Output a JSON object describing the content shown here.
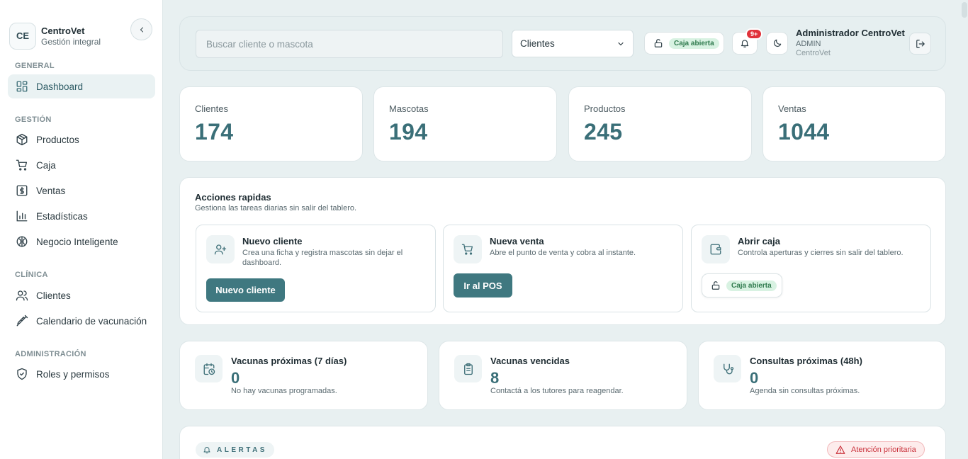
{
  "brand": {
    "initials": "CE",
    "name": "CentroVet",
    "subtitle": "Gestión integral"
  },
  "sidebar": {
    "sections": [
      {
        "label": "GENERAL"
      },
      {
        "label": "GESTIÓN"
      },
      {
        "label": "CLÍNICA"
      },
      {
        "label": "ADMINISTRACIÓN"
      }
    ],
    "items": [
      {
        "label": "Dashboard",
        "icon": "dashboard-icon",
        "active": true
      },
      {
        "label": "Productos",
        "icon": "box-icon"
      },
      {
        "label": "Caja",
        "icon": "cart-icon"
      },
      {
        "label": "Ventas",
        "icon": "dollar-icon"
      },
      {
        "label": "Estadísticas",
        "icon": "bar-chart-icon"
      },
      {
        "label": "Negocio Inteligente",
        "icon": "brain-icon"
      },
      {
        "label": "Clientes",
        "icon": "users-icon"
      },
      {
        "label": "Calendario de vacunación",
        "icon": "syringe-icon"
      },
      {
        "label": "Roles y permisos",
        "icon": "shield-icon"
      }
    ]
  },
  "topbar": {
    "search_placeholder": "Buscar cliente o mascota",
    "search_value": "",
    "select_value": "Clientes",
    "caja_status": "Caja abierta",
    "notifications_count": "9+",
    "user": {
      "name": "Administrador CentroVet",
      "role": "ADMIN",
      "org": "CentroVet"
    }
  },
  "stats": [
    {
      "label": "Clientes",
      "value": "174"
    },
    {
      "label": "Mascotas",
      "value": "194"
    },
    {
      "label": "Productos",
      "value": "245"
    },
    {
      "label": "Ventas",
      "value": "1044"
    }
  ],
  "quick_actions": {
    "title": "Acciones rapidas",
    "subtitle": "Gestiona las tareas diarias sin salir del tablero.",
    "cards": [
      {
        "title": "Nuevo cliente",
        "desc": "Crea una ficha y registra mascotas sin dejar el dashboard.",
        "button": "Nuevo cliente",
        "icon": "user-plus-icon"
      },
      {
        "title": "Nueva venta",
        "desc": "Abre el punto de venta y cobra al instante.",
        "button": "Ir al POS",
        "icon": "cart-icon"
      },
      {
        "title": "Abrir caja",
        "desc": "Controla aperturas y cierres sin salir del tablero.",
        "status": "Caja abierta",
        "icon": "wallet-icon"
      }
    ]
  },
  "info_cards": [
    {
      "title": "Vacunas próximas (7 días)",
      "value": "0",
      "desc": "No hay vacunas programadas.",
      "icon": "calendar-clock-icon"
    },
    {
      "title": "Vacunas vencidas",
      "value": "8",
      "desc": "Contactá a los tutores para reagendar.",
      "icon": "clipboard-icon"
    },
    {
      "title": "Consultas próximas (48h)",
      "value": "0",
      "desc": "Agenda sin consultas próximas.",
      "icon": "stethoscope-icon"
    }
  ],
  "alerts": {
    "label": "ALERTAS",
    "priority": "Atención prioritaria"
  },
  "colors": {
    "accent": "#3f7880",
    "value_teal": "#3a6f78",
    "success_bg": "#d8f2e2",
    "danger": "#c9303a",
    "background": "#e8f0f1"
  }
}
